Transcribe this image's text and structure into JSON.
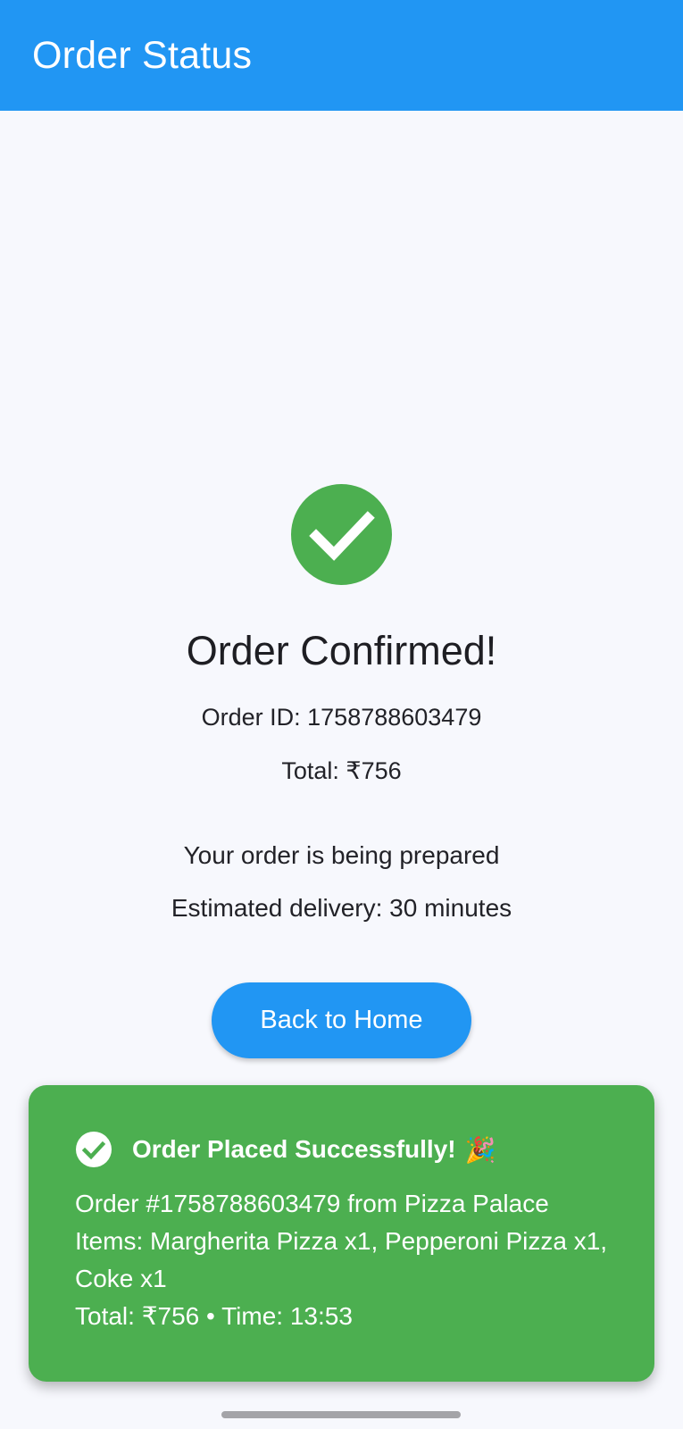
{
  "app_bar": {
    "title": "Order Status"
  },
  "confirmation": {
    "icon": "check-circle-icon",
    "heading": "Order Confirmed!",
    "order_id_line": "Order ID: 1758788603479",
    "total_line": "Total: ₹756",
    "status_line": "Your order is being prepared",
    "eta_line": "Estimated delivery: 30 minutes",
    "back_button_label": "Back to Home"
  },
  "snackbar": {
    "icon": "check-circle-icon",
    "title": "Order Placed Successfully!",
    "emoji": "🎉",
    "lines": [
      "Order #1758788603479 from Pizza Palace",
      "Items: Margherita Pizza x1, Pepperoni Pizza x1, Coke x1",
      "Total: ₹756 • Time: 13:53"
    ]
  },
  "colors": {
    "primary": "#2196F3",
    "success": "#4CAF50",
    "background": "#F7F8FD"
  }
}
